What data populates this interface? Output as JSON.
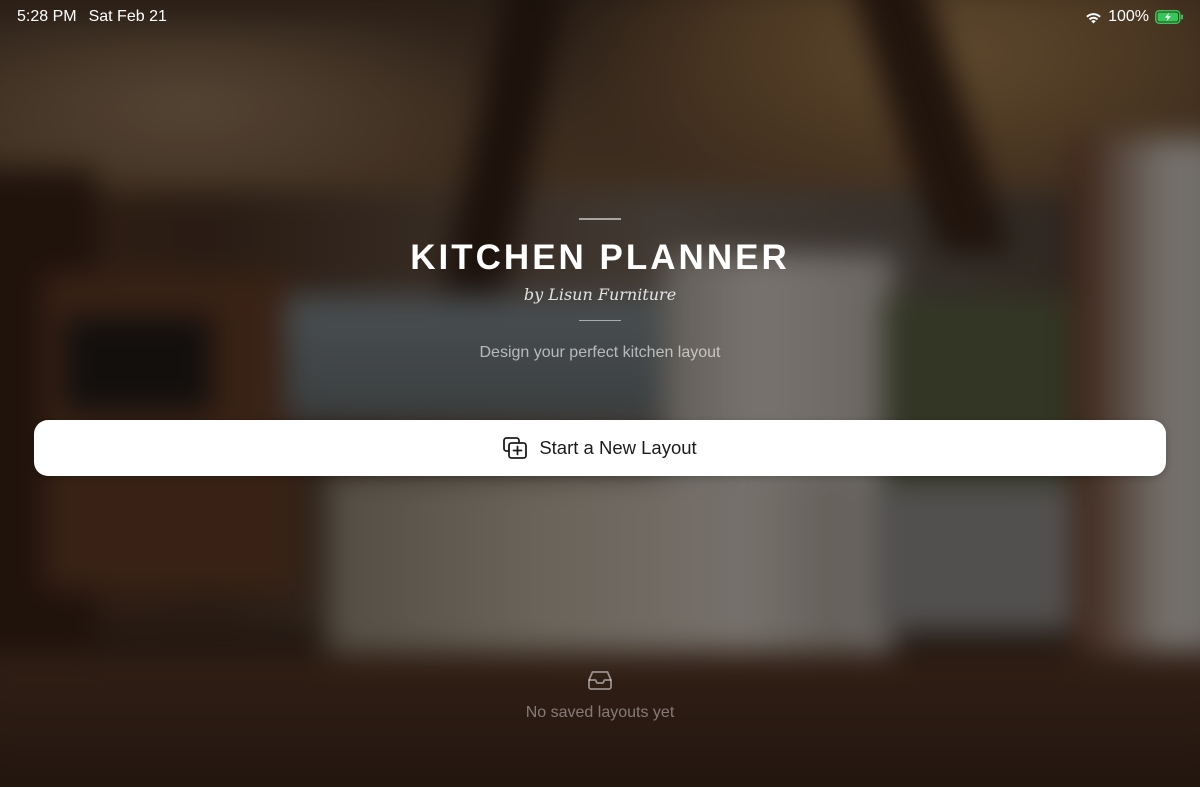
{
  "status_bar": {
    "time": "5:28 PM",
    "date": "Sat Feb 21",
    "battery": "100%",
    "icons": [
      "wifi-icon",
      "battery-charging-icon"
    ]
  },
  "header": {
    "title": "KITCHEN PLANNER",
    "byline": "by Lisun Furniture",
    "tagline": "Design your perfect kitchen layout"
  },
  "actions": {
    "start_label": "Start a New Layout",
    "start_icon": "add-layout-icon"
  },
  "empty_state": {
    "icon": "tray-icon",
    "label": "No saved layouts yet"
  },
  "colors": {
    "button_bg": "#ffffff",
    "text_primary": "#ffffff",
    "battery_green": "#34c759"
  }
}
